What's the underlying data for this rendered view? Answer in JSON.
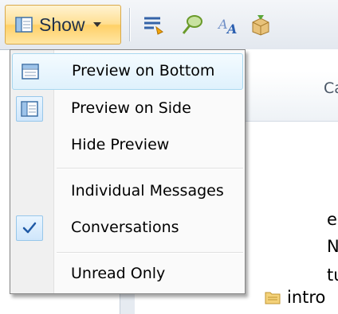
{
  "toolbar": {
    "show_button_label": "Show",
    "icons": [
      "format-lines-icon",
      "magnify-icon",
      "spell-check-icon",
      "package-icon"
    ]
  },
  "background": {
    "column_header_fragment": "Ca",
    "text_fragments": [
      "e",
      "Nc",
      "tu"
    ],
    "folder_label": "intro"
  },
  "menu": {
    "items": [
      {
        "label": "Preview on Bottom",
        "icon": "preview-bottom-icon",
        "highlighted": true
      },
      {
        "label": "Preview on Side",
        "icon": "preview-side-icon",
        "checked": true
      },
      {
        "label": "Hide Preview"
      },
      {
        "label": "Individual Messages"
      },
      {
        "label": "Conversations",
        "icon": "checkmark-icon",
        "checked": true
      },
      {
        "label": "Unread Only"
      }
    ]
  },
  "colors": {
    "button_highlight": "#ffd067",
    "menu_hover": "#dff1fc",
    "check": "#1f5aa6"
  }
}
